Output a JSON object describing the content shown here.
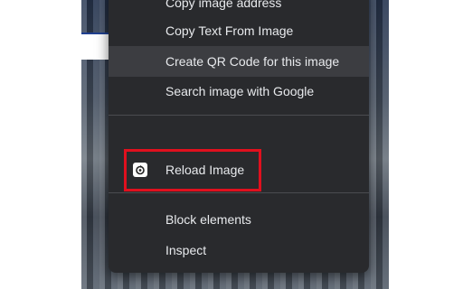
{
  "context_menu": {
    "items_top": [
      {
        "label": "Copy image address"
      },
      {
        "label": "Copy Text From Image"
      },
      {
        "label": "Create QR Code for this image"
      },
      {
        "label": "Search image with Google"
      }
    ],
    "extension_item": {
      "label": "Reload Image",
      "icon": "reload-image-extension-icon"
    },
    "items_bottom": [
      {
        "label": "Block elements"
      },
      {
        "label": "Inspect"
      }
    ],
    "hovered_item": "Create QR Code for this image"
  },
  "colors": {
    "menu_background": "#292a2d",
    "menu_text": "#e8eaed",
    "hover_background": "#3c3d41",
    "annotation_border": "#e0101e"
  }
}
